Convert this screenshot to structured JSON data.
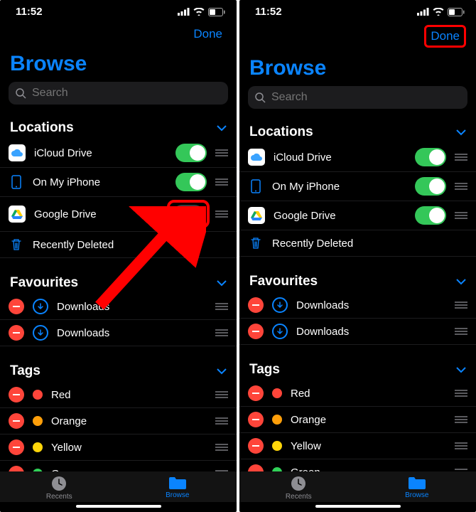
{
  "status": {
    "time": "11:52"
  },
  "nav": {
    "done": "Done"
  },
  "page_title": "Browse",
  "search": {
    "placeholder": "Search"
  },
  "sections": {
    "locations": {
      "title": "Locations",
      "items": [
        {
          "icon": "icloud",
          "label": "iCloud Drive",
          "toggle_on_left": true,
          "toggle_on_right": true
        },
        {
          "icon": "iphone",
          "label": "On My iPhone",
          "toggle_on_left": true,
          "toggle_on_right": true
        },
        {
          "icon": "gdrive",
          "label": "Google Drive",
          "toggle_on_left": false,
          "toggle_on_right": true
        },
        {
          "icon": "trash",
          "label": "Recently Deleted"
        }
      ]
    },
    "favourites": {
      "title": "Favourites",
      "items": [
        {
          "label": "Downloads"
        },
        {
          "label": "Downloads"
        }
      ]
    },
    "tags": {
      "title": "Tags",
      "items": [
        {
          "label": "Red",
          "color": "#ff453a"
        },
        {
          "label": "Orange",
          "color": "#ff9f0a"
        },
        {
          "label": "Yellow",
          "color": "#ffd60a"
        },
        {
          "label": "Green",
          "color": "#30d158"
        }
      ]
    }
  },
  "tabs": {
    "recents": "Recents",
    "browse": "Browse"
  },
  "annotations": {
    "left_highlight": "google-drive-toggle",
    "right_highlight": "done-button",
    "arrow_on_left": true
  }
}
